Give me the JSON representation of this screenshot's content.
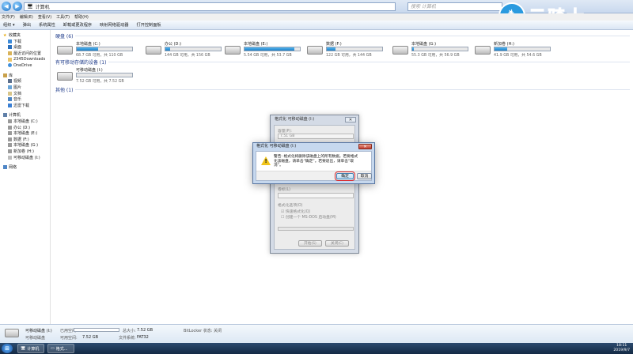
{
  "address": {
    "path": "计算机",
    "search_placeholder": "搜索 计算机"
  },
  "menu": [
    "文件(F)",
    "编辑(E)",
    "查看(V)",
    "工具(T)",
    "帮助(H)"
  ],
  "command_bar": [
    "组织 ▾",
    "弹出",
    "系统属性",
    "卸载或更改程序",
    "映射网络驱动器",
    "打开控制面板"
  ],
  "logo": {
    "text": "云骑士"
  },
  "sidebar": {
    "favorites": {
      "label": "收藏夹",
      "items": [
        "下载",
        "桌面",
        "最近访问的位置",
        "2345Downloads",
        "OneDrive"
      ]
    },
    "libraries": {
      "label": "库",
      "items": [
        "视频",
        "图片",
        "文档",
        "音乐",
        "迅雷下载"
      ]
    },
    "computer": {
      "label": "计算机",
      "items": [
        "本地磁盘 (C:)",
        "办公 (D:)",
        "本地磁盘 (E:)",
        "数据 (F:)",
        "本地磁盘 (G:)",
        "新加卷 (H:)",
        "可移动磁盘 (I:)"
      ]
    },
    "network": {
      "label": "网络"
    }
  },
  "main": {
    "hdd_group": "硬盘 (6)",
    "drives": [
      {
        "name": "本地磁盘 (C:)",
        "free": "68.7 GB 可用，共 110 GB",
        "used_frac": 0.38
      },
      {
        "name": "办公 (D:)",
        "free": "144 GB 可用，共 156 GB",
        "used_frac": 0.08
      },
      {
        "name": "本地磁盘 (E:)",
        "free": "5.54 GB 可用，共 53.7 GB",
        "used_frac": 0.9
      },
      {
        "name": "数据 (F:)",
        "free": "122 GB 可用，共 144 GB",
        "used_frac": 0.15
      },
      {
        "name": "本地磁盘 (G:)",
        "free": "55.3 GB 可用，共 56.9 GB",
        "used_frac": 0.03
      },
      {
        "name": "新加卷 (H:)",
        "free": "41.9 GB 可用，共 54.6 GB",
        "used_frac": 0.23
      }
    ],
    "removable_group": "有可移动存储的设备 (1)",
    "removable": {
      "name": "可移动磁盘 (I:)",
      "free": "7.52 GB 可用，共 7.52 GB",
      "used_frac": 0.0
    },
    "other_group": "其他 (1)"
  },
  "format_dialog": {
    "title": "格式化 可移动磁盘 (I:)",
    "close": "✕",
    "capacity_label": "容量(P):",
    "capacity_value": "7.51 GB",
    "volume_label": "卷标(L)",
    "options_label": "格式化选项(O)",
    "quick_format": "快速格式化(Q)",
    "msdos": "创建一个 MS-DOS 启动盘(M)",
    "start": "开始(S)",
    "close_btn": "关闭(C)"
  },
  "warning_dialog": {
    "title": "格式化 可移动磁盘 (I:)",
    "close": "✕",
    "message": "警告: 格式化将删除该磁盘上的所有数据。若要格式化该磁盘，请单击“确定”。若要退出，请单击“取消”。",
    "ok": "确定",
    "cancel": "取消"
  },
  "details": {
    "name": "可移动磁盘 (I:)",
    "type": "可移动磁盘",
    "used_label": "已用空间:",
    "free_label": "可用空间:",
    "free_value": "7.52 GB",
    "total_label": "总大小:",
    "total_value": "7.52 GB",
    "fs_label": "文件系统:",
    "fs_value": "FAT32",
    "bitlocker": "BitLocker 状态: 关闭"
  },
  "taskbar": {
    "items": [
      "计算机",
      "格式..."
    ],
    "time": "18:11",
    "date": "2019/9/7"
  }
}
